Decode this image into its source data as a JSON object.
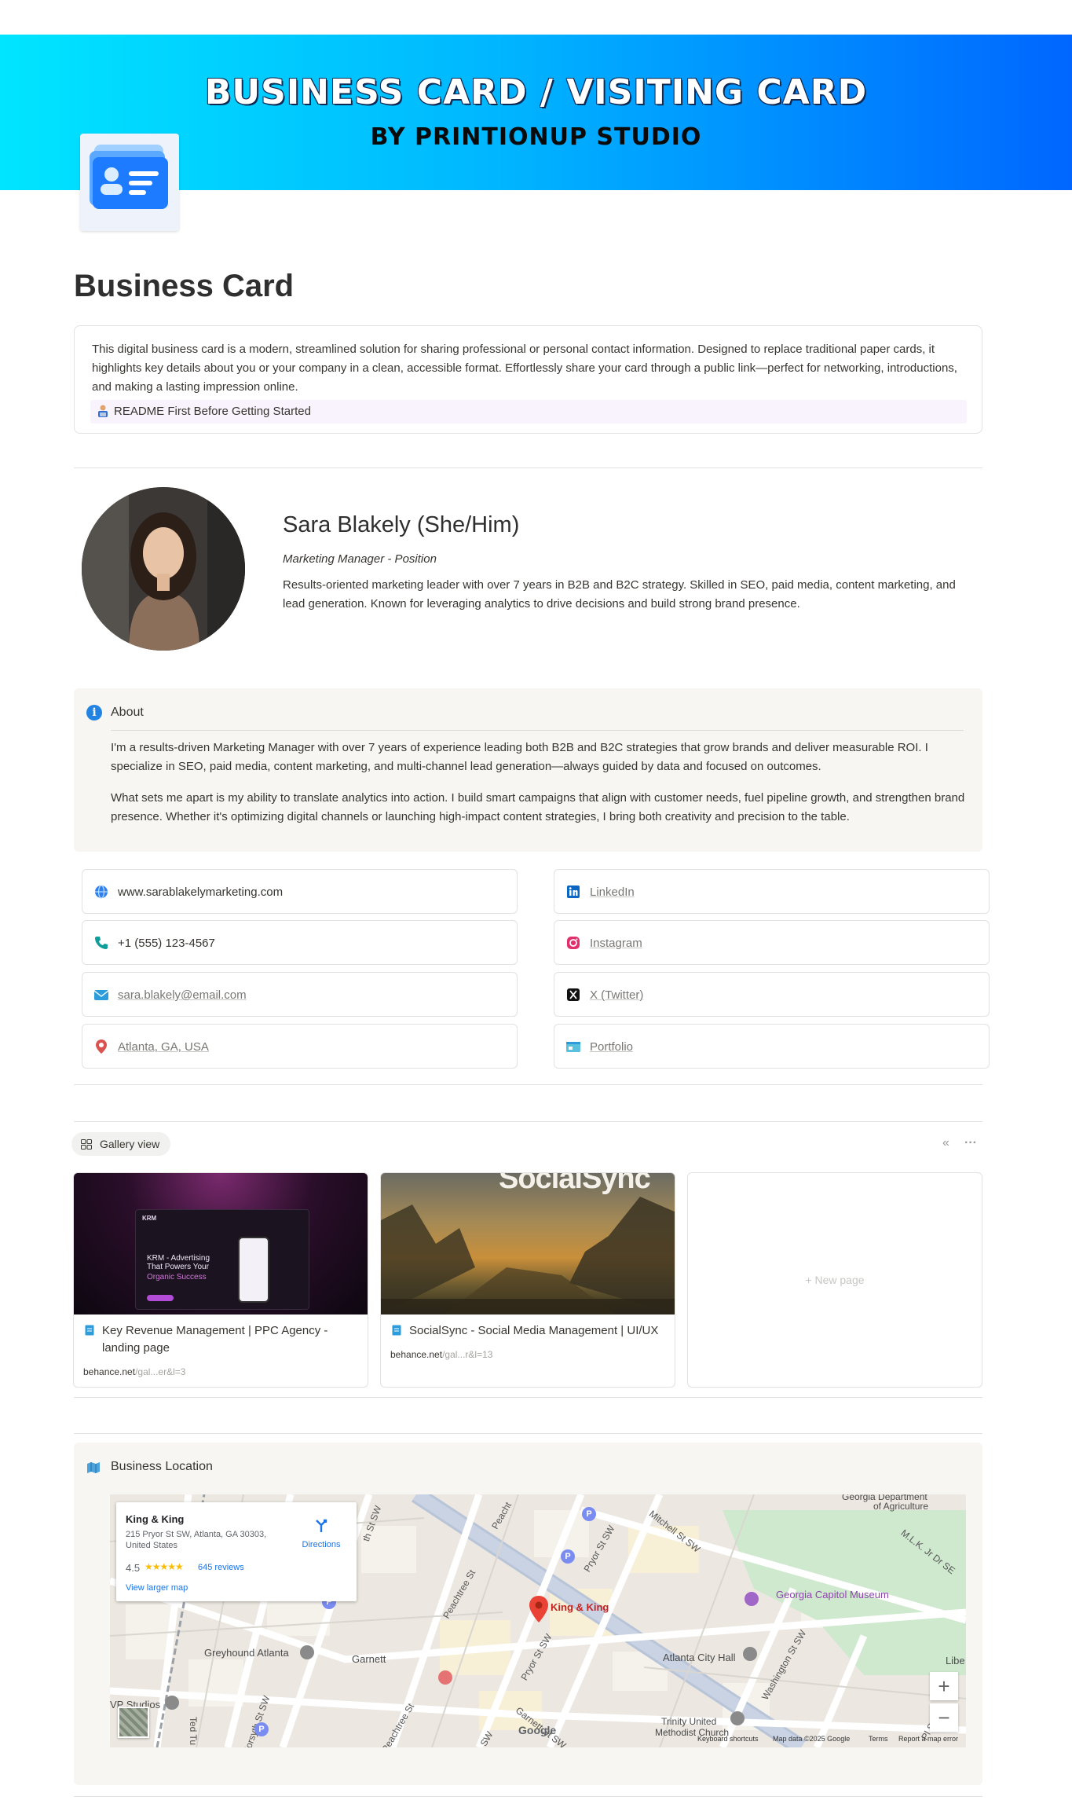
{
  "banner": {
    "title": "BUSINESS CARD / VISITING CARD",
    "subtitle": "BY PRINTIONUP STUDIO"
  },
  "page": {
    "title": "Business Card",
    "description": "This digital business card is a modern, streamlined solution for sharing professional or personal contact information. Designed to replace traditional paper cards, it highlights key details about you or your company in a clean, accessible format. Effortlessly share your card through a public link—perfect for networking, introductions, and making a lasting impression online.",
    "readme_label": "README First Before Getting Started"
  },
  "profile": {
    "name": "Sara Blakely (She/Him)",
    "position": "Marketing Manager - Position",
    "bio": "Results-oriented marketing leader with over 7 years in B2B and B2C strategy. Skilled in SEO, paid media, content marketing, and lead generation. Known for leveraging analytics to drive decisions and build strong brand presence."
  },
  "about": {
    "title": "About",
    "paragraphs": [
      "I'm a results-driven Marketing Manager with over 7 years of experience leading both B2B and B2C strategies that grow brands and deliver measurable ROI. I specialize in SEO, paid media, content marketing, and multi-channel lead generation—always guided by data and focused on outcomes.",
      "What sets me apart is my ability to translate analytics into action. I build smart campaigns that align with customer needs, fuel pipeline growth, and strengthen brand presence. Whether it's optimizing digital channels or launching high-impact content strategies, I bring both creativity and precision to the table."
    ]
  },
  "contacts_left": [
    {
      "icon": "globe-icon",
      "text": "www.sarablakelymarketing.com"
    },
    {
      "icon": "phone-icon",
      "text": "+1 (555) 123-4567"
    },
    {
      "icon": "email-icon",
      "text": "sara.blakely@email.com"
    },
    {
      "icon": "location-pin-icon",
      "text": "Atlanta, GA, USA"
    }
  ],
  "contacts_right": [
    {
      "icon": "linkedin-icon",
      "text": "LinkedIn"
    },
    {
      "icon": "instagram-icon",
      "text": "Instagram"
    },
    {
      "icon": "x-twitter-icon",
      "text": "X (Twitter)"
    },
    {
      "icon": "portfolio-icon",
      "text": "Portfolio"
    }
  ],
  "gallery": {
    "tab_label": "Gallery view",
    "cards": [
      {
        "title": "Key Revenue Management | PPC Agency - landing page",
        "url_domain": "behance.net",
        "url_rest": "/gal...er&l=3",
        "image_text": {
          "logo": "KRM",
          "headline": "KRM - Advertising That Powers Your",
          "accent": "Organic Success"
        }
      },
      {
        "title": "SocialSync - Social Media Management | UI/UX",
        "url_domain": "behance.net",
        "url_rest": "/gal...r&l=13",
        "image_text": {
          "headline": "SocialSync"
        }
      }
    ],
    "new_page_label": "+ New page"
  },
  "location": {
    "title": "Business Location",
    "popup": {
      "name": "King & King",
      "address": "215 Pryor St SW, Atlanta, GA 30303, United States",
      "rating": "4.5",
      "stars": "★★★★★",
      "reviews": "645 reviews",
      "directions": "Directions",
      "larger_map": "View larger map"
    },
    "labels": {
      "pin": "King & King",
      "museum": "Georgia Capitol Museum",
      "city_hall": "Atlanta City Hall",
      "church1": "Trinity United",
      "church2": "Methodist Church",
      "greyhound": "Greyhound Atlanta",
      "garnett": "Garnett",
      "vp": "VP Studios",
      "agri1": "Georgia Department",
      "agri2": "of Agriculture",
      "libe": "Libe",
      "mlk": "M.L.K. Jr Dr SE",
      "mitchell": "Mitchell St SW",
      "peachtree": "Peachtree St",
      "peachtree2": "Peachtree St",
      "peacht": "Peacht",
      "pryor": "Pryor St SW",
      "pryor2": "Pryor St SW",
      "washington": "Washington St SW",
      "garnett_st": "Garnett St SW",
      "forsyth": "Forsyth St SW",
      "ted": "Ted Tu",
      "th_st": "th St SW",
      "pl_sw": "Pl SW",
      "sw": "SW"
    },
    "attribution": {
      "google": "Google",
      "shortcuts": "Keyboard shortcuts",
      "mapdata": "Map data ©2025 Google",
      "terms": "Terms",
      "report": "Report a map error"
    },
    "zoom_in": "+",
    "zoom_out": "−"
  }
}
